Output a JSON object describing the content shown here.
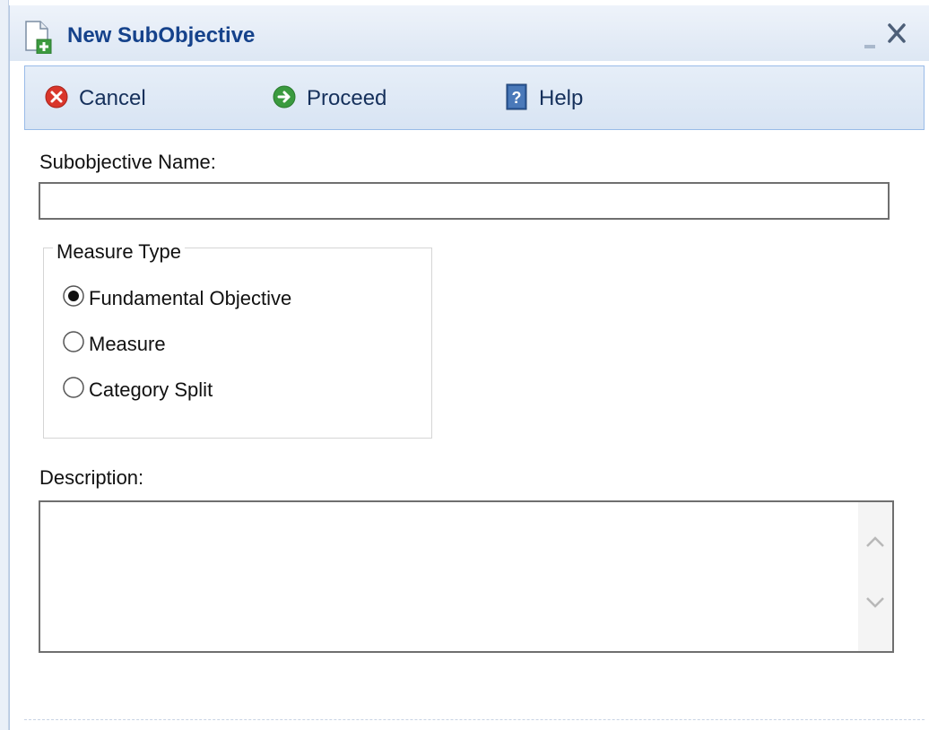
{
  "window": {
    "title": "New SubObjective"
  },
  "toolbar": {
    "cancel_label": "Cancel",
    "proceed_label": "Proceed",
    "help_label": "Help"
  },
  "form": {
    "name_label": "Subobjective Name:",
    "name_value": "",
    "measure_type": {
      "legend": "Measure Type",
      "options": [
        {
          "label": "Fundamental Objective",
          "selected": true
        },
        {
          "label": "Measure",
          "selected": false
        },
        {
          "label": "Category Split",
          "selected": false
        }
      ]
    },
    "description_label": "Description:",
    "description_value": ""
  },
  "icons": {
    "title": "new-document-icon",
    "close": "close-icon",
    "minimize": "minimize-icon",
    "cancel": "cancel-icon",
    "proceed": "proceed-arrow-icon",
    "help": "help-icon"
  },
  "colors": {
    "title_text": "#15428b",
    "toolbar_border": "#99bbe8",
    "cancel_red": "#d9362b",
    "proceed_green": "#3a9a3f",
    "help_blue": "#2f5d9e"
  }
}
